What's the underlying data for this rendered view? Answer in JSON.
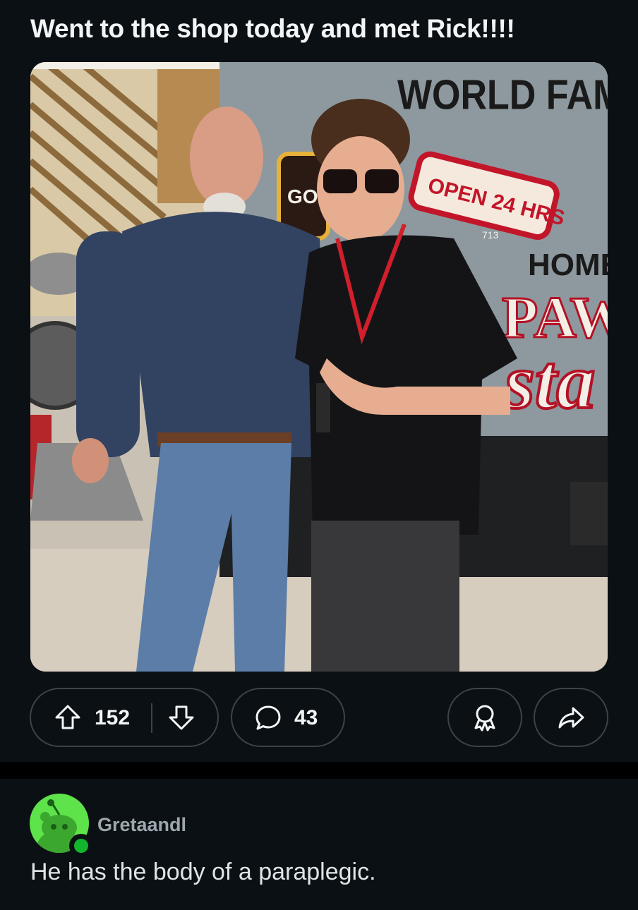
{
  "post": {
    "title": "Went to the shop today and met Rick!!!!",
    "image": {
      "sign_top_text": "WORLD FAMOUS",
      "sign_open_text": "OPEN 24 HRS",
      "sign_number_text": "713",
      "sign_home_text": "HOME TO",
      "sign_paw_text": "PAW",
      "sign_sta_text": "sta",
      "sign_go_text": "GO"
    }
  },
  "actions": {
    "score": "152",
    "comment_count": "43"
  },
  "comment": {
    "username": "Gretaandl",
    "body": "He has the body of a paraplegic."
  },
  "colors": {
    "background": "#0b1014",
    "pill_border": "#3a4448",
    "avatar_green": "#5ee34a",
    "online_green": "#12b52c"
  },
  "icons": [
    "upvote-icon",
    "downvote-icon",
    "comment-icon",
    "award-icon",
    "share-icon",
    "snoo-icon"
  ]
}
